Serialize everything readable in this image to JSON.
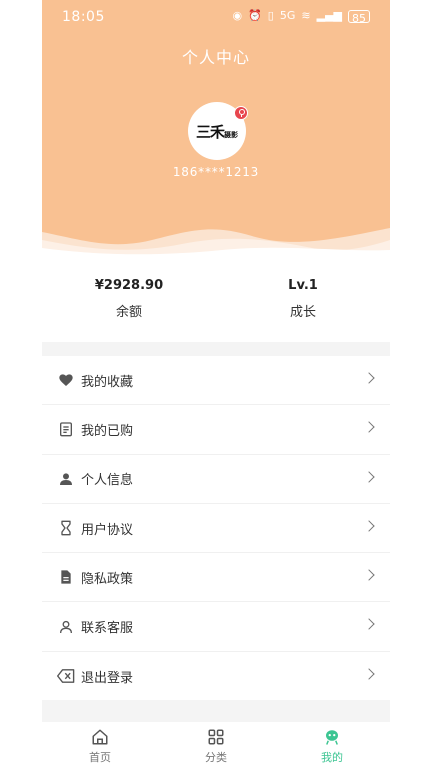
{
  "status_bar": {
    "time": "18:05",
    "network": "5G",
    "battery": "85"
  },
  "header": {
    "title": "个人中心",
    "avatar_brand_big": "三禾",
    "avatar_brand_small": "摄影",
    "phone": "186****1213"
  },
  "stats": [
    {
      "value": "¥2928.90",
      "label": "余额"
    },
    {
      "value": "Lv.1",
      "label": "成长"
    }
  ],
  "menu": [
    {
      "label": "我的收藏",
      "icon": "heart-icon"
    },
    {
      "label": "我的已购",
      "icon": "clipboard-icon"
    },
    {
      "label": "个人信息",
      "icon": "user-icon"
    },
    {
      "label": "用户协议",
      "icon": "hourglass-icon"
    },
    {
      "label": "隐私政策",
      "icon": "document-icon"
    },
    {
      "label": "联系客服",
      "icon": "user-outline-icon"
    },
    {
      "label": "退出登录",
      "icon": "backspace-icon"
    }
  ],
  "tabbar": [
    {
      "label": "首页",
      "icon": "home-icon",
      "active": false
    },
    {
      "label": "分类",
      "icon": "grid-icon",
      "active": false
    },
    {
      "label": "我的",
      "icon": "mascot-icon",
      "active": true
    }
  ],
  "colors": {
    "header_bg": "#f9c192",
    "accent": "#3cc592",
    "badge": "#e8464e"
  }
}
